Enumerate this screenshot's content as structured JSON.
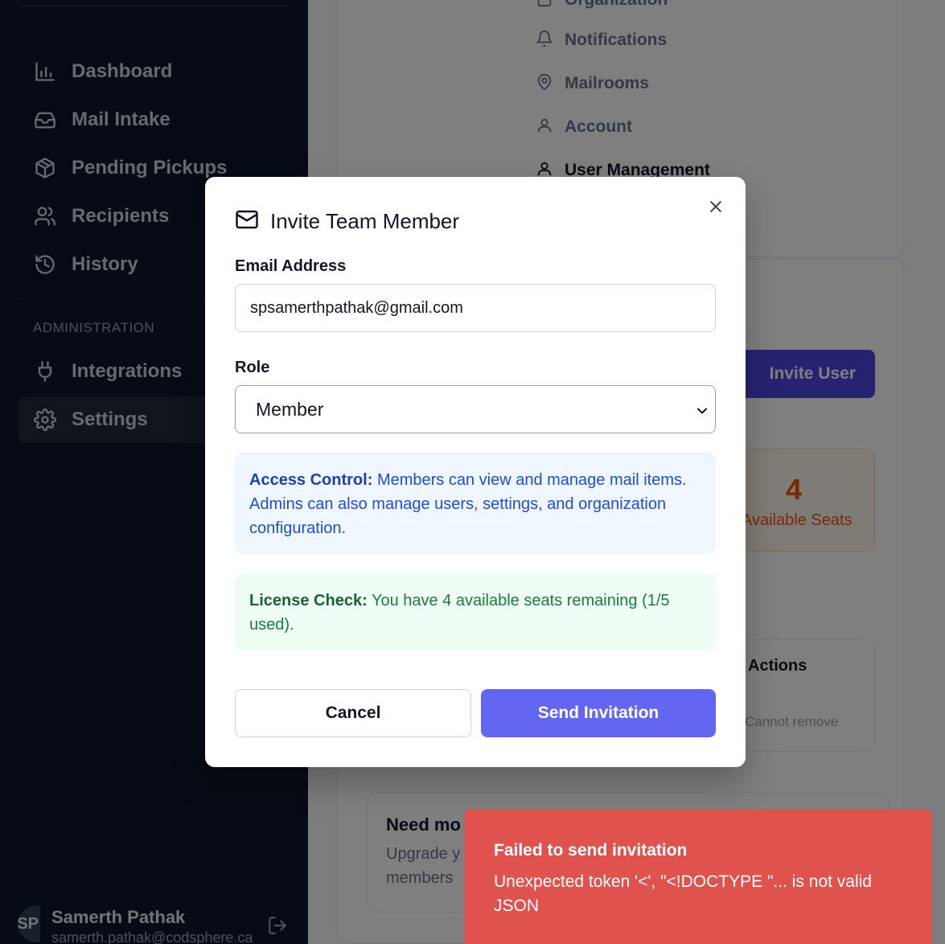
{
  "sidebar": {
    "nav": [
      {
        "label": "Dashboard",
        "icon": "bar-chart-icon"
      },
      {
        "label": "Mail Intake",
        "icon": "inbox-icon"
      },
      {
        "label": "Pending Pickups",
        "icon": "package-icon"
      },
      {
        "label": "Recipients",
        "icon": "users-icon"
      },
      {
        "label": "History",
        "icon": "history-icon"
      }
    ],
    "section_label": "ADMINISTRATION",
    "admin_nav": [
      {
        "label": "Integrations",
        "icon": "plug-icon"
      },
      {
        "label": "Settings",
        "icon": "gear-icon"
      }
    ],
    "user": {
      "initials": "SP",
      "name": "Samerth Pathak",
      "email": "samerth.pathak@codsphere.ca"
    }
  },
  "settings_nav": [
    {
      "label": "Organization",
      "icon": "building-icon"
    },
    {
      "label": "Notifications",
      "icon": "bell-icon"
    },
    {
      "label": "Mailrooms",
      "icon": "map-pin-icon"
    },
    {
      "label": "Account",
      "icon": "user-icon"
    },
    {
      "label": "User Management",
      "icon": "user-icon"
    }
  ],
  "background": {
    "invite_user_label": "Invite User",
    "seats_value": "4",
    "seats_label": "Available Seats",
    "actions_header": "Actions",
    "cannot_remove": "Cannot remove",
    "need_more_title": "Need mo",
    "upgrade_text": "Upgrade y members"
  },
  "modal": {
    "title": "Invite Team Member",
    "email_label": "Email Address",
    "email_value": "spsamerthpathak@gmail.com",
    "role_label": "Role",
    "role_value": "Member",
    "access_title": "Access Control:",
    "access_text": "Members can view and manage mail items. Admins can also manage users, settings, and organization configuration.",
    "license_title": "License Check:",
    "license_text": "You have 4 available seats remaining (1/5 used).",
    "cancel_label": "Cancel",
    "send_label": "Send Invitation"
  },
  "toast": {
    "title": "Failed to send invitation",
    "message": "Unexpected token '<', \"<!DOCTYPE \"... is not valid JSON"
  },
  "colors": {
    "sidebar_bg": "#0f172a",
    "primary": "#6366f1",
    "error": "#e0524d"
  }
}
